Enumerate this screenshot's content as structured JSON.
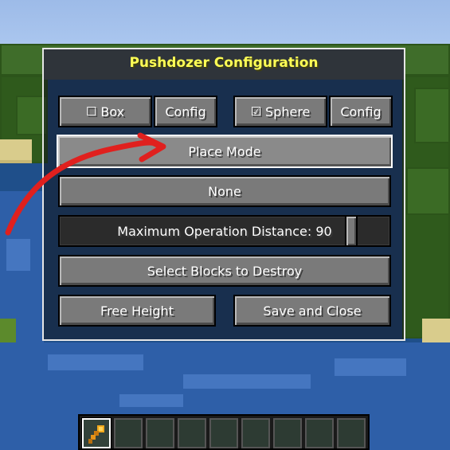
{
  "dialog": {
    "title": "Pushdozer Configuration",
    "box_toggle": {
      "glyph": "☐",
      "label": "Box",
      "checked": false
    },
    "box_config_label": "Config",
    "sphere_toggle": {
      "glyph": "☑",
      "label": "Sphere",
      "checked": true
    },
    "sphere_config_label": "Config",
    "place_mode_label": "Place Mode",
    "none_label": "None",
    "slider": {
      "label": "Maximum Operation Distance: 90",
      "value": 90,
      "fraction": 0.9
    },
    "select_blocks_label": "Select Blocks to Destroy",
    "free_height_label": "Free Height",
    "save_close_label": "Save and Close"
  },
  "hotbar": {
    "slots": 9,
    "selected": 0,
    "selected_item_icon": "pushdozer-tool-icon"
  },
  "colors": {
    "title": "#ffff55",
    "annotation_arrow": "#e0201e",
    "hover_border": "#ffffff"
  }
}
